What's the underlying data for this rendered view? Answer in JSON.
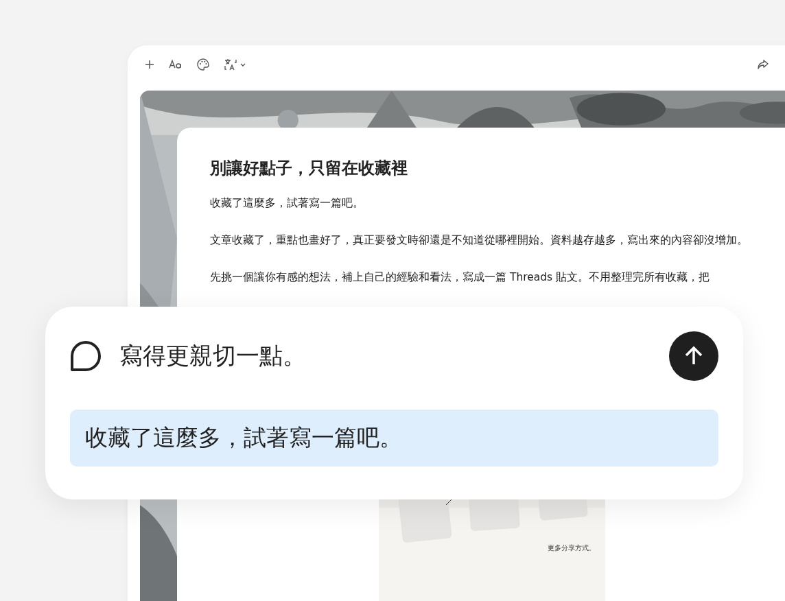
{
  "toolbar": {
    "translate_menu_expanded": false
  },
  "document": {
    "title": "別讓好點子，只留在收藏裡",
    "paragraphs": [
      "收藏了這麼多，試著寫一篇吧。",
      "文章收藏了，重點也畫好了，真正要發文時卻還是不知道從哪裡開始。資料越存越多，寫出來的內容卻沒增加。",
      "先挑一個讓你有感的想法，補上自己的經驗和看法，寫成一篇 Threads 貼文。不用整理完所有收藏，把"
    ],
    "embedded_image": {
      "caption": "更多分享方式。"
    }
  },
  "prompt_panel": {
    "prompt": "寫得更親切一點。",
    "quoted_selection": "收藏了這麼多，試著寫一篇吧。"
  }
}
